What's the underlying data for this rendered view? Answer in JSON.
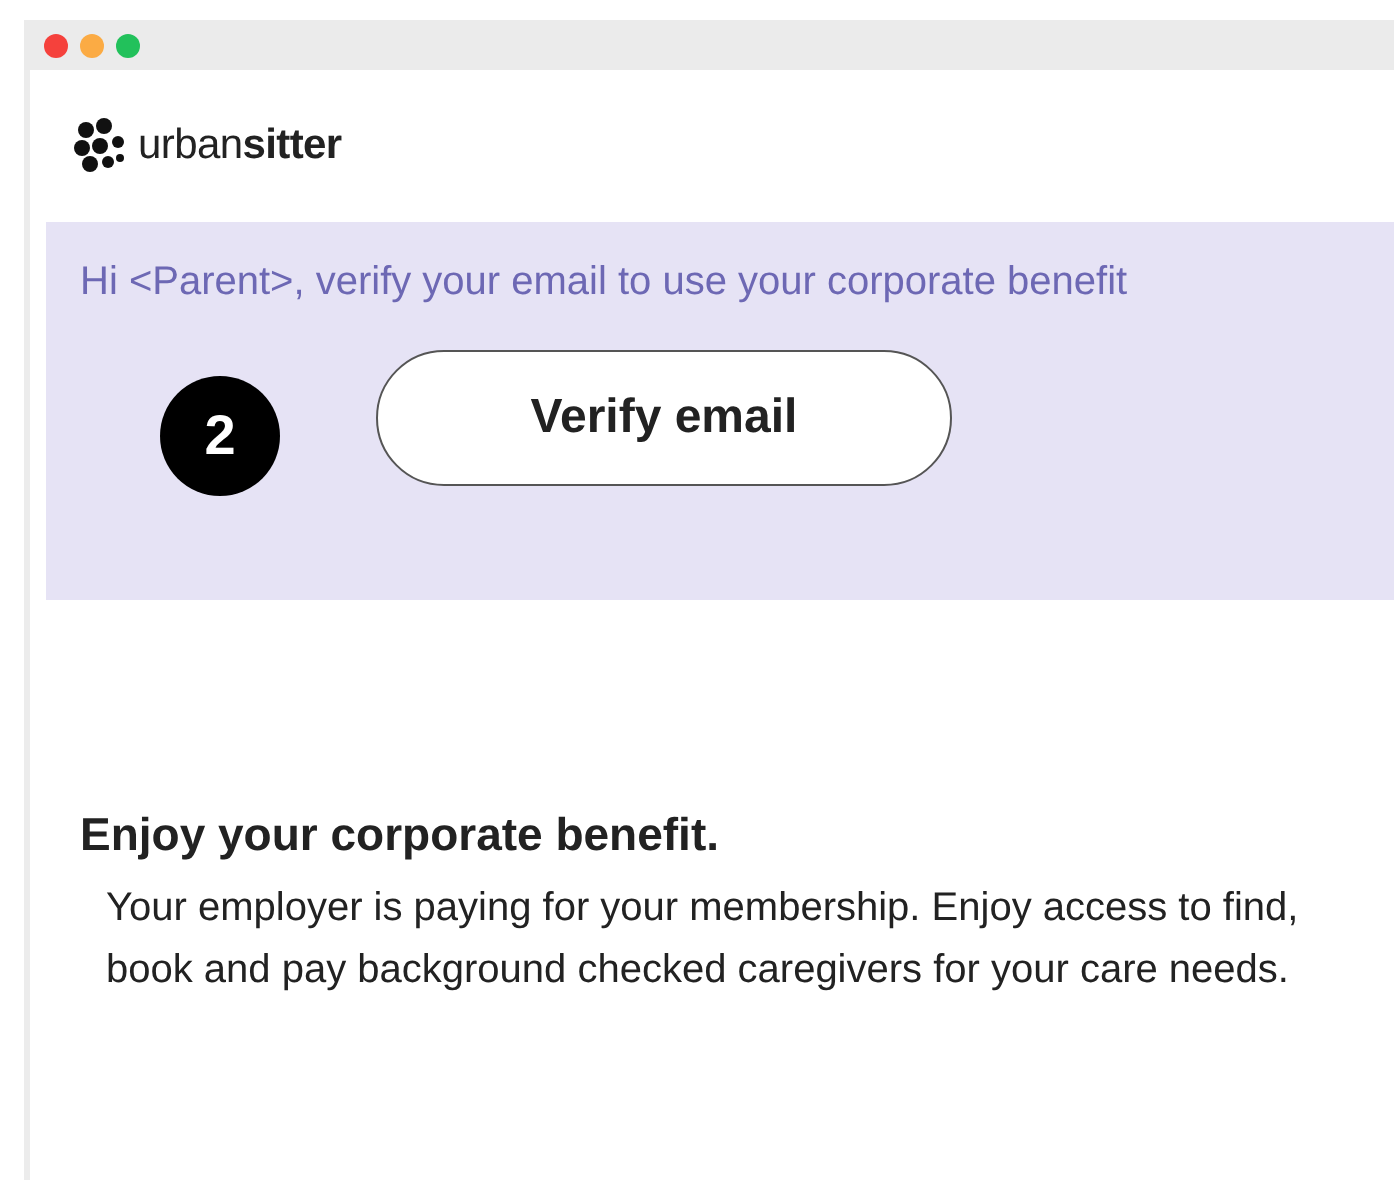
{
  "brand": {
    "name": "urban**sitter**"
  },
  "banner": {
    "message": "Hi <Parent>, verify your email to use your corporate benefit",
    "step_badge": "2",
    "button": "Verify email"
  },
  "benefit": {
    "title": "Enjoy your corporate benefit.",
    "body": "Your employer is paying for your membership. Enjoy access to find, book and pay background checked caregivers for your care needs."
  }
}
